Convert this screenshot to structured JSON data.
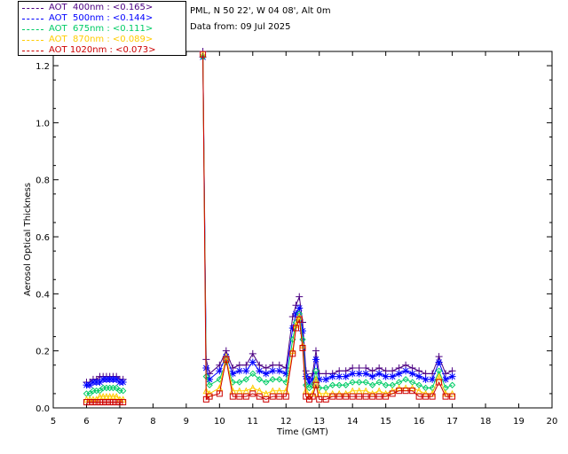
{
  "header": {
    "site": "PML, N 50 22', W 04 08', Alt 0m",
    "date_line": "Data from: 09 Jul 2025"
  },
  "legend": [
    {
      "label": "AOT  400nm : <0.165>",
      "color": "#4b0082"
    },
    {
      "label": "AOT  500nm : <0.144>",
      "color": "#0000ff"
    },
    {
      "label": "AOT  675nm : <0.111>",
      "color": "#00cc66"
    },
    {
      "label": "AOT  870nm : <0.089>",
      "color": "#ffcc00"
    },
    {
      "label": "AOT 1020nm : <0.073>",
      "color": "#cc0000"
    }
  ],
  "chart_data": {
    "type": "line",
    "xlabel": "Time (GMT)",
    "ylabel": "Aerosol Optical Thickness",
    "xlim": [
      5,
      20
    ],
    "ylim": [
      0,
      1.25
    ],
    "xticks": [
      5,
      6,
      7,
      8,
      9,
      10,
      11,
      12,
      13,
      14,
      15,
      16,
      17,
      18,
      19,
      20
    ],
    "yticks": [
      0.0,
      0.2,
      0.4,
      0.6,
      0.8,
      1.0,
      1.2
    ],
    "ytick_labels": [
      "0.0",
      "0.2",
      "0.4",
      "0.6",
      "0.8",
      "1.0",
      "1.2"
    ],
    "grid": false,
    "legend_position": "top-left",
    "x": [
      6.0,
      6.1,
      6.2,
      6.3,
      6.4,
      6.5,
      6.6,
      6.7,
      6.8,
      6.9,
      7.0,
      7.1,
      9.5,
      9.6,
      9.7,
      10.0,
      10.2,
      10.4,
      10.6,
      10.8,
      11.0,
      11.2,
      11.4,
      11.6,
      11.8,
      12.0,
      12.2,
      12.3,
      12.4,
      12.5,
      12.6,
      12.7,
      12.8,
      12.9,
      13.0,
      13.2,
      13.4,
      13.6,
      13.8,
      14.0,
      14.2,
      14.4,
      14.6,
      14.8,
      15.0,
      15.2,
      15.4,
      15.6,
      15.8,
      16.0,
      16.2,
      16.4,
      16.6,
      16.8,
      17.0
    ],
    "series": [
      {
        "name": "AOT  400nm",
        "marker": "plus",
        "values": [
          0.09,
          0.09,
          0.1,
          0.1,
          0.11,
          0.11,
          0.11,
          0.11,
          0.11,
          0.11,
          0.1,
          0.1,
          1.25,
          0.17,
          0.12,
          0.15,
          0.2,
          0.14,
          0.15,
          0.15,
          0.19,
          0.15,
          0.14,
          0.15,
          0.15,
          0.14,
          0.32,
          0.36,
          0.39,
          0.3,
          0.13,
          0.1,
          0.12,
          0.2,
          0.12,
          0.12,
          0.12,
          0.13,
          0.13,
          0.14,
          0.14,
          0.14,
          0.13,
          0.14,
          0.13,
          0.13,
          0.14,
          0.15,
          0.14,
          0.13,
          0.12,
          0.12,
          0.18,
          0.12,
          0.13
        ]
      },
      {
        "name": "AOT  500nm",
        "marker": "asterisk",
        "values": [
          0.08,
          0.08,
          0.09,
          0.09,
          0.09,
          0.1,
          0.1,
          0.1,
          0.1,
          0.1,
          0.09,
          0.09,
          1.23,
          0.14,
          0.1,
          0.13,
          0.18,
          0.12,
          0.13,
          0.13,
          0.16,
          0.13,
          0.12,
          0.13,
          0.13,
          0.12,
          0.28,
          0.33,
          0.35,
          0.27,
          0.11,
          0.09,
          0.1,
          0.17,
          0.1,
          0.1,
          0.11,
          0.11,
          0.11,
          0.12,
          0.12,
          0.12,
          0.11,
          0.12,
          0.11,
          0.11,
          0.12,
          0.13,
          0.12,
          0.11,
          0.1,
          0.1,
          0.16,
          0.1,
          0.11
        ]
      },
      {
        "name": "AOT  675nm",
        "marker": "diamond",
        "values": [
          0.05,
          0.05,
          0.06,
          0.06,
          0.06,
          0.07,
          0.07,
          0.07,
          0.07,
          0.07,
          0.06,
          0.06,
          1.23,
          0.11,
          0.08,
          0.1,
          0.16,
          0.09,
          0.09,
          0.1,
          0.12,
          0.1,
          0.09,
          0.1,
          0.1,
          0.09,
          0.24,
          0.3,
          0.33,
          0.24,
          0.08,
          0.07,
          0.08,
          0.13,
          0.07,
          0.07,
          0.08,
          0.08,
          0.08,
          0.09,
          0.09,
          0.09,
          0.08,
          0.09,
          0.08,
          0.08,
          0.09,
          0.1,
          0.09,
          0.08,
          0.07,
          0.07,
          0.13,
          0.07,
          0.08
        ]
      },
      {
        "name": "AOT  870nm",
        "marker": "triangle",
        "values": [
          0.03,
          0.03,
          0.03,
          0.03,
          0.04,
          0.04,
          0.04,
          0.04,
          0.04,
          0.04,
          0.03,
          0.03,
          1.24,
          0.06,
          0.05,
          0.07,
          0.18,
          0.06,
          0.06,
          0.06,
          0.07,
          0.06,
          0.05,
          0.06,
          0.06,
          0.06,
          0.2,
          0.29,
          0.32,
          0.22,
          0.06,
          0.04,
          0.05,
          0.1,
          0.05,
          0.05,
          0.05,
          0.05,
          0.05,
          0.06,
          0.06,
          0.06,
          0.05,
          0.06,
          0.05,
          0.06,
          0.07,
          0.07,
          0.07,
          0.06,
          0.05,
          0.05,
          0.11,
          0.05,
          0.05
        ]
      },
      {
        "name": "AOT 1020nm",
        "marker": "square",
        "values": [
          0.02,
          0.02,
          0.02,
          0.02,
          0.02,
          0.02,
          0.02,
          0.02,
          0.02,
          0.02,
          0.02,
          0.02,
          1.24,
          0.03,
          0.04,
          0.05,
          0.17,
          0.04,
          0.04,
          0.04,
          0.05,
          0.04,
          0.03,
          0.04,
          0.04,
          0.04,
          0.19,
          0.28,
          0.31,
          0.21,
          0.04,
          0.03,
          0.04,
          0.08,
          0.03,
          0.03,
          0.04,
          0.04,
          0.04,
          0.04,
          0.04,
          0.04,
          0.04,
          0.04,
          0.04,
          0.05,
          0.06,
          0.06,
          0.06,
          0.04,
          0.04,
          0.04,
          0.09,
          0.04,
          0.04
        ]
      }
    ]
  }
}
